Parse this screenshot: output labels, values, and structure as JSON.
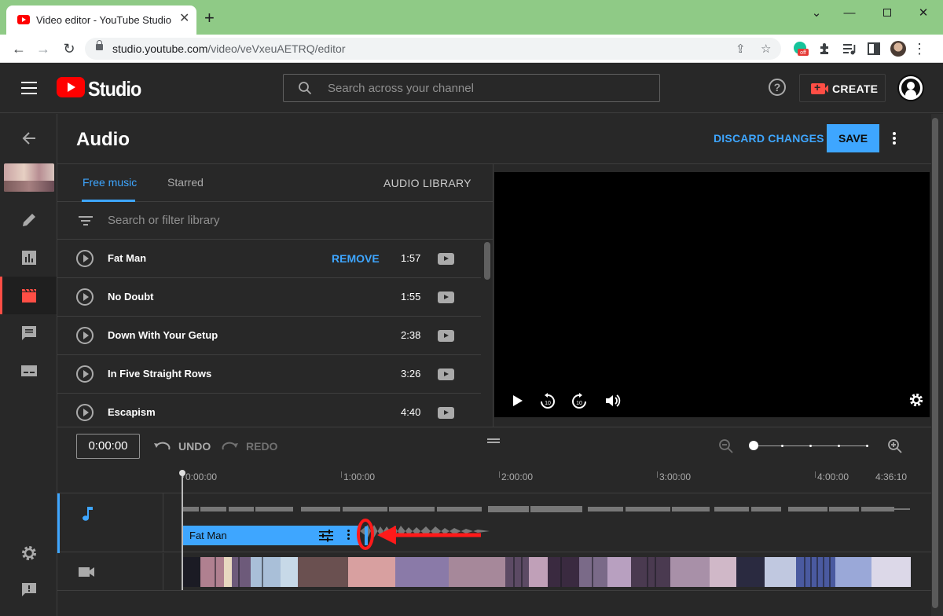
{
  "browser": {
    "tab_title": "Video editor - YouTube Studio",
    "url_host": "studio.youtube.com",
    "url_path": "/video/veVxeuAETRQ/editor",
    "extension_badge": "off"
  },
  "header": {
    "brand": "Studio",
    "search_placeholder": "Search across your channel",
    "create_label": "CREATE"
  },
  "editor": {
    "title": "Audio",
    "discard_label": "DISCARD CHANGES",
    "save_label": "SAVE"
  },
  "audio_panel": {
    "tabs": [
      {
        "label": "Free music",
        "active": true
      },
      {
        "label": "Starred",
        "active": false
      }
    ],
    "audio_library_label": "AUDIO LIBRARY",
    "filter_placeholder": "Search or filter library",
    "tracks": [
      {
        "title": "Fat Man",
        "action": "REMOVE",
        "duration": "1:57"
      },
      {
        "title": "No Doubt",
        "action": "",
        "duration": "1:55"
      },
      {
        "title": "Down With Your Getup",
        "action": "",
        "duration": "2:38"
      },
      {
        "title": "In Five Straight Rows",
        "action": "",
        "duration": "3:26"
      },
      {
        "title": "Escapism",
        "action": "",
        "duration": "4:40"
      }
    ]
  },
  "timeline": {
    "current_time": "0:00:00",
    "undo_label": "UNDO",
    "redo_label": "REDO",
    "ruler": [
      "0:00:00",
      "1:00:00",
      "2:00:00",
      "3:00:00",
      "4:00:00",
      "4:36:10"
    ],
    "audio_clip_label": "Fat Man",
    "zoom_level": 0
  },
  "colors": {
    "accent": "#3ea6ff",
    "brand_red": "#ff0000",
    "annotation_red": "#ff1a1a",
    "background": "#282828"
  }
}
